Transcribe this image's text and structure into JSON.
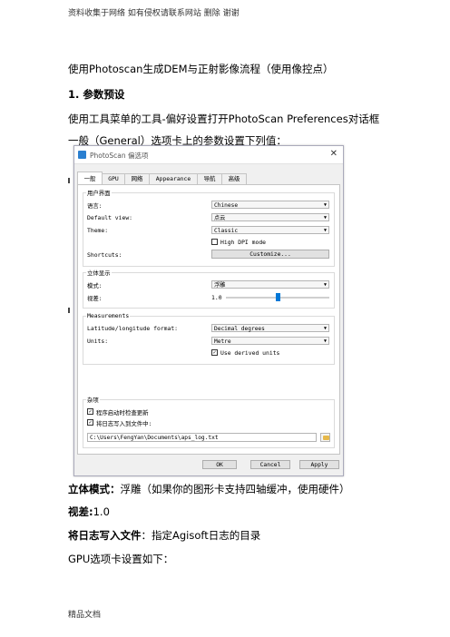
{
  "page": {
    "header": "资料收集于网络 如有侵权请联系网站 删除 谢谢",
    "footer": "精品文档",
    "heading_line": "使用Photoscan生成DEM与正射影像流程（使用像控点）",
    "section_title": "1. 参数预设",
    "para1": "使用工具菜单的工具-偏好设置打开PhotoScan Preferences对话框",
    "para2": "一般（General）选项卡上的参数设置下列值：",
    "note1_label": "立体模式：",
    "note1_text": "浮雕（如果你的图形卡支持四轴缓冲，使用硬件）",
    "note2_label": "视差:",
    "note2_text": "1.0",
    "note3_label": "将日志写入文件",
    "note3_text": "：指定Agisoft日志的目录",
    "note4": "GPU选项卡设置如下："
  },
  "dialog": {
    "title": "PhotoScan 偏选项",
    "close_glyph": "✕",
    "tabs": [
      "一般",
      "GPU",
      "网络",
      "Appearance",
      "导航",
      "高级"
    ],
    "ui_group": {
      "title": "用户界面",
      "language_label": "语言:",
      "language_value": "Chinese",
      "default_view_label": "Default view:",
      "default_view_value": "点云",
      "theme_label": "Theme:",
      "theme_value": "Classic",
      "high_dpi_label": "High DPI mode",
      "high_dpi_checked": false,
      "shortcuts_label": "Shortcuts:",
      "customize_button": "Customize..."
    },
    "stereo_group": {
      "title": "立体显示",
      "mode_label": "模式:",
      "mode_value": "浮雕",
      "parallax_label": "视差:",
      "parallax_value": "1.0",
      "parallax_slider_fraction": 0.5
    },
    "measurements_group": {
      "title": "Measurements",
      "latlon_label": "Latitude/longitude format:",
      "latlon_value": "Decimal degrees",
      "units_label": "Units:",
      "units_value": "Metre",
      "derived_units_label": "Use derived units",
      "derived_units_checked": true
    },
    "misc_group": {
      "title": "杂项",
      "check_updates_label": "程序启动时检查更新",
      "check_updates_checked": true,
      "write_log_label": "将日志写入到文件中:",
      "write_log_checked": true,
      "log_path": "C:\\Users\\FengYan\\Documents\\aps_log.txt"
    },
    "buttons": {
      "ok": "OK",
      "cancel": "Cancel",
      "apply": "Apply"
    },
    "checkmark_glyph": "✓",
    "dropdown_glyph": "▼"
  }
}
